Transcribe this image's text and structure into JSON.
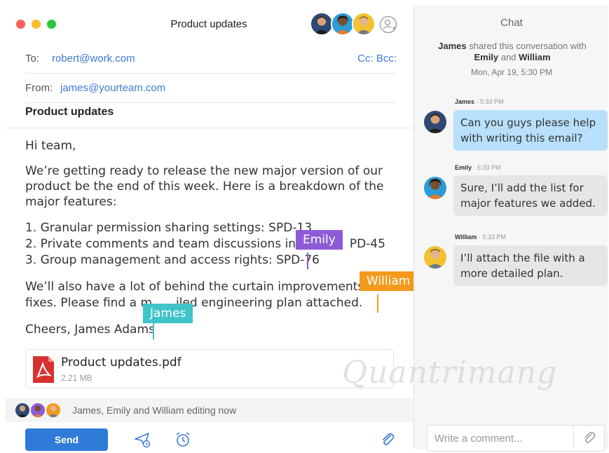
{
  "email": {
    "window_title": "Product updates",
    "to_label": "To:",
    "to_value": "robert@work.com",
    "cc_bcc": "Cc: Bcc:",
    "from_label": "From:",
    "from_value": "james@yourteam.com",
    "subject": "Product updates",
    "greeting": "Hi team,",
    "intro": [
      "We’re getting ready to release the new major version of our",
      "product be the end of this week. Here is a breakdown of the",
      "major features:"
    ],
    "features": [
      "1. Granular permission sharing settings: SPD-13",
      "2. Private comments and team discussions in c",
      "PD-45",
      "3. Group management and access rights: SPD-76"
    ],
    "paragraph": [
      "We’ll also have a lot of behind the curtain improvements a",
      "fixes. Please find a m",
      "iled engineering plan attached."
    ],
    "signature": "Cheers, James Adams",
    "attachment": {
      "name": "Product updates.pdf",
      "size": "2.21 MB"
    },
    "editing_text": "James, Emily and William editing now",
    "send_label": "Send",
    "cursors": {
      "emily": "Emily",
      "william": "William",
      "james": "James"
    }
  },
  "chat": {
    "title": "Chat",
    "shared_by": "James",
    "shared_text": "shared this conversation with",
    "shared_with_1": "Emily",
    "shared_and": "and",
    "shared_with_2": "William",
    "shared_date": "Mon, Apr 19, 5:30 PM",
    "messages": [
      {
        "author": "James",
        "time": "· 5:33 PM",
        "lines": [
          "Can you guys please help",
          "with writing this email?"
        ]
      },
      {
        "author": "Emily",
        "time": "· 5:33 PM",
        "lines": [
          "Sure, I’ll add the list for",
          "major features we added."
        ]
      },
      {
        "author": "William",
        "time": "· 5:33 PM",
        "lines": [
          "I’ll attach the file with a",
          "more detailed plan."
        ]
      }
    ],
    "comment_placeholder": "Write a comment..."
  },
  "watermark": "Quantrimang",
  "colors": {
    "accent_blue": "#2f7bd8",
    "link_blue": "#3d7ad6",
    "emily": "#8e5bd6",
    "william": "#f39a1d",
    "james": "#3fc4c9",
    "bubble_blue": "#b9e0fb"
  },
  "icons": [
    "add-user-icon",
    "pdf-icon",
    "send-later-icon",
    "reminder-icon",
    "paperclip-icon"
  ]
}
